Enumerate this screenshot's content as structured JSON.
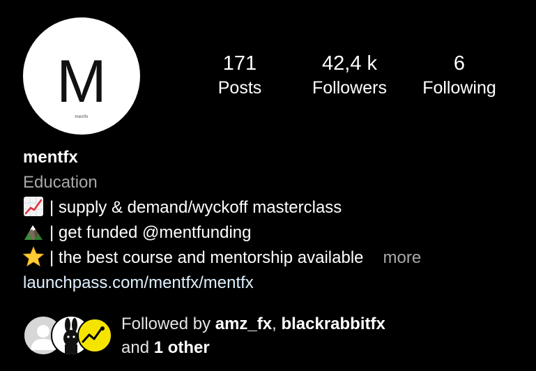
{
  "profile": {
    "avatar_letter": "M",
    "avatar_subtext": "mentfx",
    "username": "mentfx",
    "category": "Education"
  },
  "stats": [
    {
      "value": "171",
      "label": "Posts"
    },
    {
      "value": "42,4 k",
      "label": "Followers"
    },
    {
      "value": "6",
      "label": "Following"
    }
  ],
  "bio": {
    "lines": [
      {
        "icon": "chart-increasing-icon",
        "text": "| supply & demand/wyckoff masterclass"
      },
      {
        "icon": "mountain-icon",
        "text": "| get funded @mentfunding"
      },
      {
        "icon": "star-icon",
        "text": "| the best course and mentorship available"
      }
    ],
    "more_label": "more",
    "link": "launchpass.com/mentfx/mentfx"
  },
  "followed_by": {
    "prefix": "Followed by ",
    "user1": "amz_fx",
    "separator": ", ",
    "user2": "blackrabbitfx",
    "and_text": "and ",
    "others": "1 other"
  },
  "colors": {
    "background": "#000000",
    "text": "#ffffff",
    "muted": "#a8a8a8",
    "link": "#e0f1ff"
  }
}
